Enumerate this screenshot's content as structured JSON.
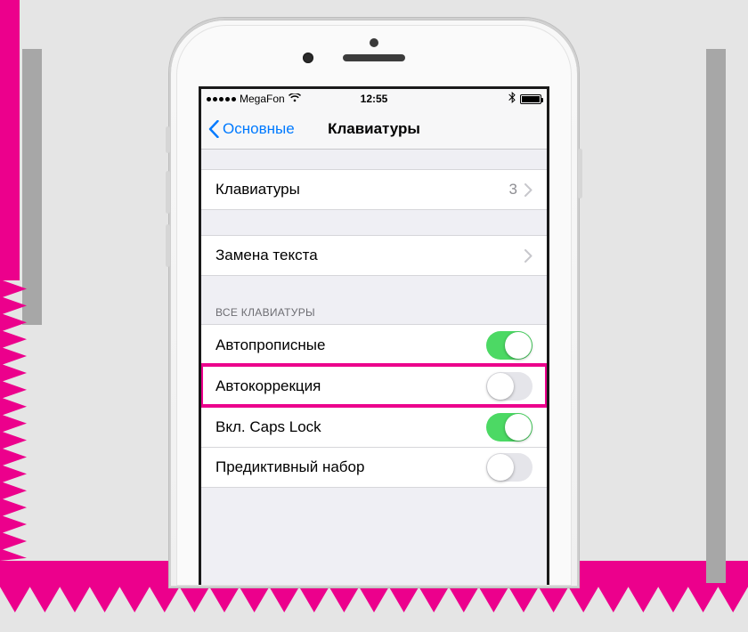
{
  "statusbar": {
    "carrier": "MegaFon",
    "time": "12:55"
  },
  "navbar": {
    "back_label": "Основные",
    "title": "Клавиатуры"
  },
  "rows": {
    "keyboards": {
      "label": "Клавиатуры",
      "count": "3"
    },
    "text_replace": {
      "label": "Замена текста"
    }
  },
  "section_header": "ВСЕ КЛАВИАТУРЫ",
  "toggles": {
    "autocap": {
      "label": "Автопрописные",
      "on": true
    },
    "autocorr": {
      "label": "Автокоррекция",
      "on": false
    },
    "capslock": {
      "label": "Вкл. Caps Lock",
      "on": true
    },
    "predictive": {
      "label": "Предиктивный набор",
      "on": false
    }
  }
}
